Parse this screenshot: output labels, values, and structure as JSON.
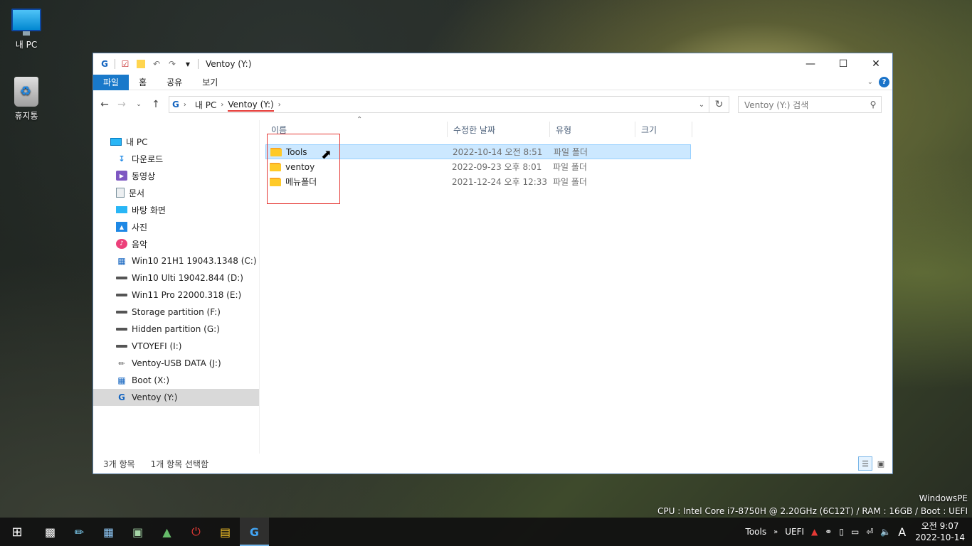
{
  "desktop": {
    "icons": [
      {
        "label": "내 PC",
        "icon": "computer-icon"
      },
      {
        "label": "휴지통",
        "icon": "recycle-bin-icon"
      }
    ]
  },
  "window": {
    "title": "Ventoy (Y:)",
    "ribbon_tabs": [
      "파일",
      "홈",
      "공유",
      "보기"
    ],
    "address": {
      "segments": [
        "내 PC",
        "Ventoy (Y:)"
      ]
    },
    "search_placeholder": "Ventoy (Y:) 검색",
    "sidebar": {
      "items": [
        {
          "label": "내 PC",
          "icon": "computer-icon"
        },
        {
          "label": "다운로드",
          "icon": "download-icon"
        },
        {
          "label": "동영상",
          "icon": "video-icon"
        },
        {
          "label": "문서",
          "icon": "document-icon"
        },
        {
          "label": "바탕 화면",
          "icon": "desktop-icon"
        },
        {
          "label": "사진",
          "icon": "picture-icon"
        },
        {
          "label": "음악",
          "icon": "music-icon"
        },
        {
          "label": "Win10 21H1 19043.1348 (C:)",
          "icon": "windows-drive-icon"
        },
        {
          "label": "Win10 Ulti 19042.844 (D:)",
          "icon": "drive-icon"
        },
        {
          "label": "Win11 Pro 22000.318 (E:)",
          "icon": "drive-icon"
        },
        {
          "label": "Storage partition (F:)",
          "icon": "drive-icon"
        },
        {
          "label": "Hidden partition (G:)",
          "icon": "drive-icon"
        },
        {
          "label": "VTOYEFI (I:)",
          "icon": "drive-icon"
        },
        {
          "label": "Ventoy-USB DATA (J:)",
          "icon": "usb-icon"
        },
        {
          "label": "Boot (X:)",
          "icon": "windows-drive-icon"
        },
        {
          "label": "Ventoy (Y:)",
          "icon": "ventoy-icon",
          "selected": true
        }
      ]
    },
    "columns": [
      "이름",
      "수정한 날짜",
      "유형",
      "크기"
    ],
    "files": [
      {
        "name": "Tools",
        "date": "2022-10-14 오전 8:51",
        "type": "파일 폴더",
        "selected": true
      },
      {
        "name": "ventoy",
        "date": "2022-09-23 오후 8:01",
        "type": "파일 폴더"
      },
      {
        "name": "메뉴폴더",
        "date": "2021-12-24 오후 12:33",
        "type": "파일 폴더"
      }
    ],
    "status": {
      "count": "3개 항목",
      "selected": "1개 항목 선택함"
    }
  },
  "watermark": {
    "line1": "WindowsPE",
    "line2": "CPU : Intel Core i7-8750H @ 2.20GHz (6C12T) / RAM : 16GB / Boot : UEFI"
  },
  "taskbar": {
    "tools_label": "Tools",
    "uefi_label": "UEFI",
    "ime_label": "A",
    "time": "오전 9:07",
    "date": "2022-10-14"
  }
}
